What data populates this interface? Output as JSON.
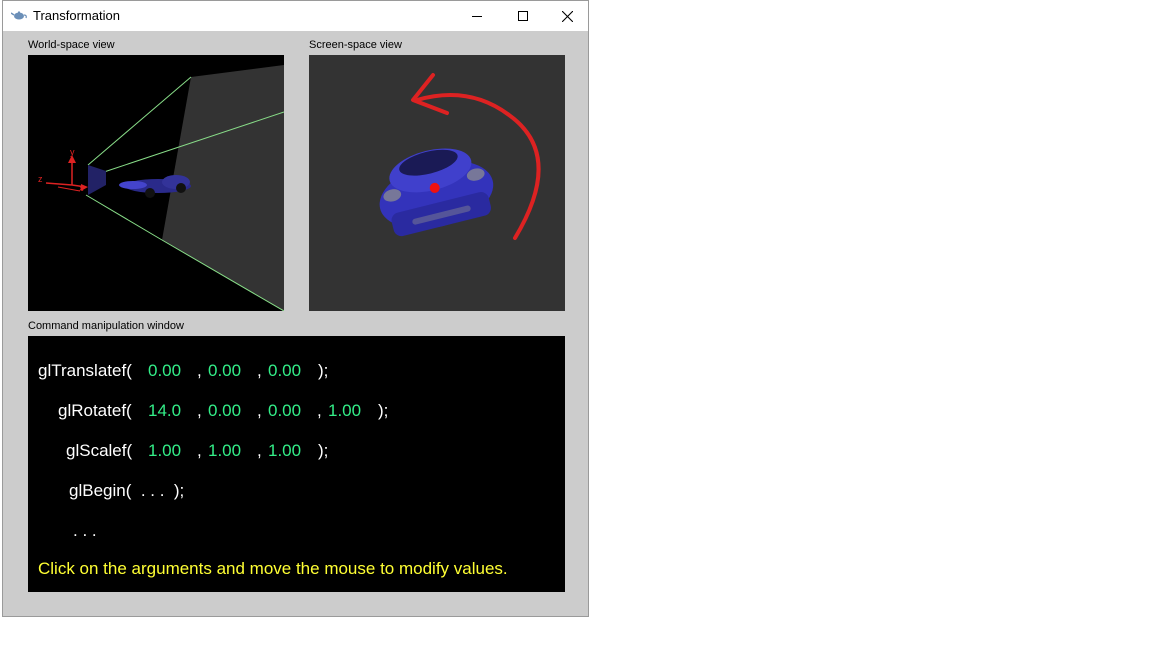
{
  "window": {
    "title": "Transformation"
  },
  "panels": {
    "world_label": "World-space view",
    "screen_label": "Screen-space view",
    "command_label": "Command manipulation window"
  },
  "axes": {
    "x": "x",
    "y": "y",
    "z": "z"
  },
  "commands": {
    "translate": {
      "fn": "glTranslatef(",
      "args": [
        "0.00",
        "0.00",
        "0.00"
      ],
      "close": ");"
    },
    "rotate": {
      "fn": "glRotatef(",
      "args": [
        "14.0",
        "0.00",
        "0.00",
        "1.00"
      ],
      "close": ");"
    },
    "scale": {
      "fn": "glScalef(",
      "args": [
        "1.00",
        "1.00",
        "1.00"
      ],
      "close": ");"
    },
    "begin": {
      "text": "glBegin(  . . .  );"
    },
    "ellipsis": ". . .",
    "separator": ",",
    "hint": "Click on the arguments and move the mouse to modify values."
  },
  "colors": {
    "argument": "#33ee88",
    "hint": "#ffff33",
    "frustum": "#88dd88",
    "car": "#3333cc",
    "annotation_arrow": "#dd2222"
  },
  "icons": {
    "app": "teapot-icon",
    "minimize": "minimize-icon",
    "maximize": "maximize-icon",
    "close": "close-icon"
  }
}
